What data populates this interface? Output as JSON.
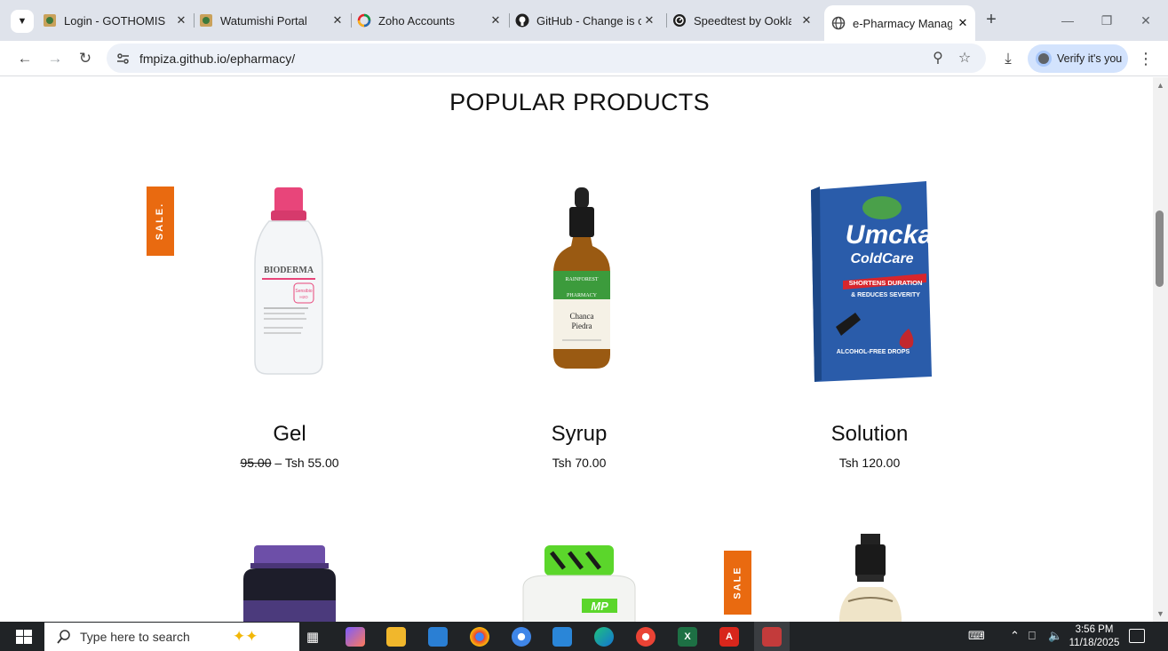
{
  "browser": {
    "tabs": [
      {
        "title": "Login - GOTHOMIS",
        "icon": "emblem-icon"
      },
      {
        "title": "Watumishi Portal",
        "icon": "emblem-icon"
      },
      {
        "title": "Zoho Accounts",
        "icon": "zoho-icon"
      },
      {
        "title": "GitHub - Change is cc",
        "icon": "github-icon"
      },
      {
        "title": "Speedtest by Ookla -",
        "icon": "speedtest-icon"
      },
      {
        "title": "e-Pharmacy Manager",
        "icon": "globe-icon"
      }
    ],
    "url": "fmpiza.github.io/epharmacy/",
    "verify_label": "Verify it's you"
  },
  "page": {
    "section_title": "POPULAR PRODUCTS",
    "sale_label": "SALE.",
    "sale_label_2": "SALE",
    "products": [
      {
        "name": "Gel",
        "old_price": "95.00",
        "separator": " – ",
        "price": "Tsh 55.00"
      },
      {
        "name": "Syrup",
        "price": "Tsh 70.00"
      },
      {
        "name": "Solution",
        "price": "Tsh 120.00"
      }
    ],
    "product_images": {
      "gel": {
        "brand": "BIODERMA",
        "line": "Sensibio",
        "subline": "H2O"
      },
      "syrup": {
        "brand": "RAINFOREST",
        "brand2": "PHARMACY",
        "line1": "Chanca",
        "line2": "Piedra"
      },
      "solution": {
        "brand": "Umcka",
        "line": "ColdCare",
        "tag1": "SHORTENS DURATION",
        "tag2": "& REDUCES SEVERITY",
        "footer": "ALCOHOL-FREE DROPS"
      }
    }
  },
  "taskbar": {
    "search_placeholder": "Type here to search",
    "time": "3:56 PM",
    "date": "11/18/2025"
  },
  "colors": {
    "sale": "#e96a10",
    "tabstrip": "#dfe3eb",
    "omnibox": "#edf1f8",
    "taskbar": "#202326"
  }
}
